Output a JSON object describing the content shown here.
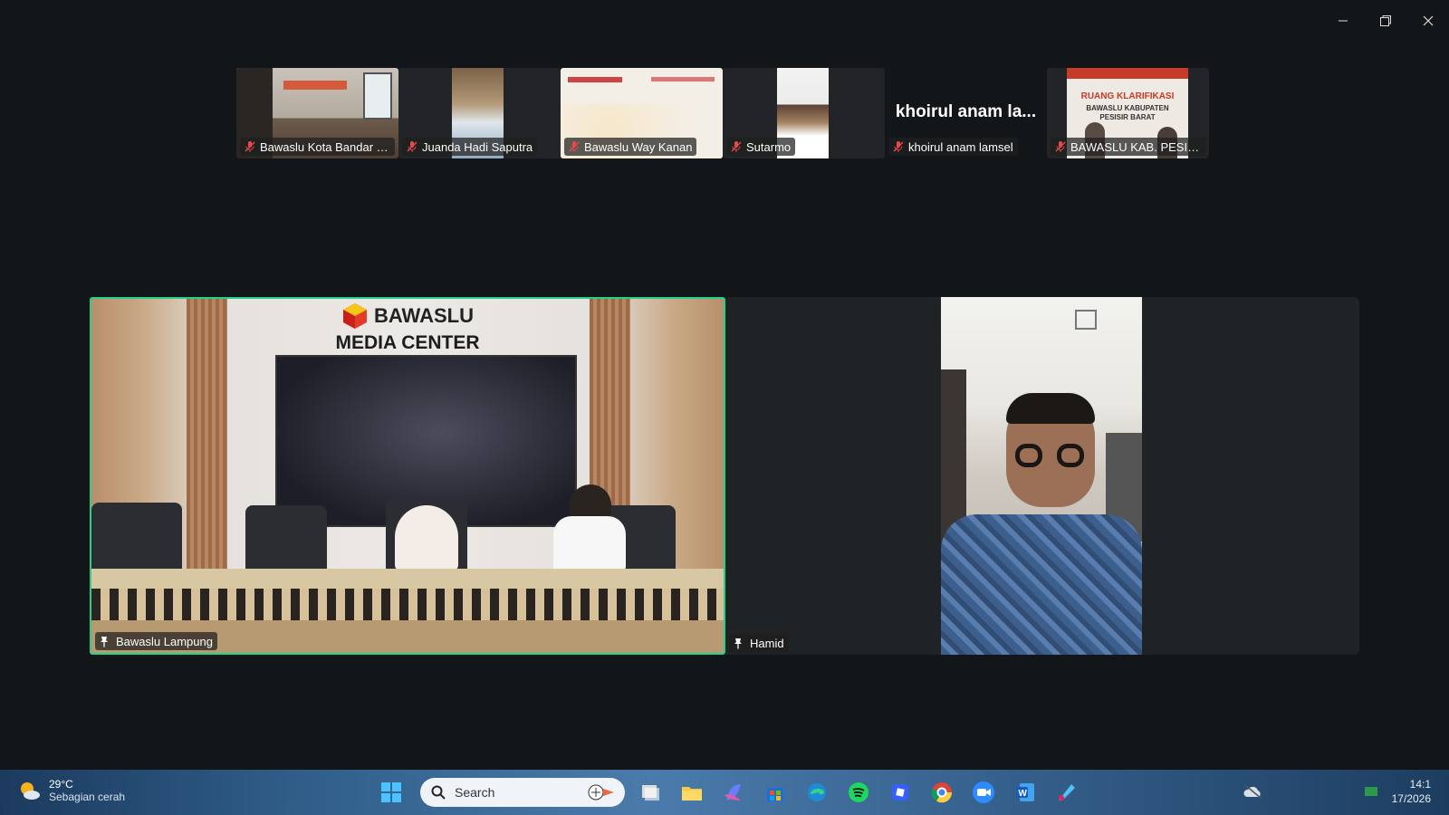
{
  "thumbnails": [
    {
      "name": "Bawaslu Kota Bandar L...",
      "muted": true,
      "kind": "room"
    },
    {
      "name": "Juanda Hadi Saputra",
      "muted": true,
      "kind": "person"
    },
    {
      "name": "Bawaslu Way Kanan",
      "muted": true,
      "kind": "slide"
    },
    {
      "name": "Sutarmo",
      "muted": true,
      "kind": "person"
    },
    {
      "name": "khoirul anam lamsel",
      "display_name": "khoirul anam la...",
      "muted": true,
      "kind": "noVideo"
    },
    {
      "name": "BAWASLU KAB. PESISI...",
      "muted": true,
      "kind": "room2"
    }
  ],
  "main_tiles": [
    {
      "name": "Bawaslu Lampung",
      "pinned": true,
      "active_speaker": true
    },
    {
      "name": "Hamid",
      "pinned": true,
      "active_speaker": false
    }
  ],
  "room_signage": {
    "brand": "BAWASLU",
    "subtitle": "MEDIA CENTER"
  },
  "thumb_room_sign": {
    "line1": "RUANG KLARIFIKASI",
    "line2": "BAWASLU KABUPATEN",
    "line3": "PESISIR BARAT"
  },
  "taskbar": {
    "weather_temp": "29°C",
    "weather_desc": "Sebagian cerah",
    "search_placeholder": "Search",
    "apps": [
      "task-view-icon",
      "file-explorer-icon",
      "copilot-icon",
      "store-icon",
      "edge-icon",
      "spotify-icon",
      "roblox-icon",
      "chrome-icon",
      "zoom-icon",
      "word-icon",
      "paint-icon"
    ],
    "clock_time": "14:1",
    "clock_date": "17/2026"
  },
  "colors": {
    "active_speaker_border": "#23d18b",
    "background": "#131619",
    "tile_bg": "#202326"
  }
}
